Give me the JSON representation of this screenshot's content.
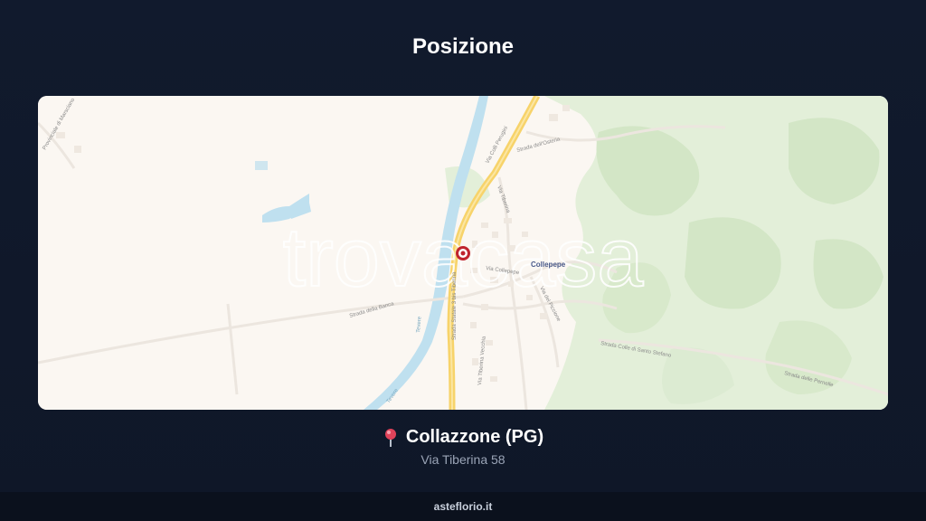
{
  "header": {
    "title": "Posizione"
  },
  "map": {
    "watermark": "trovacasa",
    "marker_icon": "location-marker",
    "labels": {
      "town": "Collepepe",
      "road_banca": "Strada della Banca",
      "road_ss3bis": "Strada Statale 3 bis Tiberina",
      "road_ss3bis_alt": "Tangenziale di Perugia",
      "via_tiberina_1": "Via Tiberina",
      "via_tiberina_2": "Via Tiberina Vecchia",
      "via_del_piccione": "Via del Piccione",
      "strada_osteria": "Strada dell'Osteria",
      "via_colli_perugini": "Via Colli Perugini",
      "strada_santo_stefano": "Strada Colle di Santo Stefano",
      "strada_pernelle": "Strada delle Pernelle",
      "provinciale": "Provinciale di Marsciano",
      "river_1": "Tevere",
      "river_2": "Tevere",
      "via_collepepe": "Via Collepepe"
    },
    "colors": {
      "land": "#fbf7f2",
      "green": "#dcebd2",
      "green_dark": "#cfe4c3",
      "water": "#bfe0ef",
      "highway": "#f7d36a",
      "marker": "#c0242f"
    }
  },
  "location": {
    "pin_icon": "map-pin-icon",
    "name": "Collazzone (PG)",
    "address": "Via Tiberina 58"
  },
  "footer": {
    "site": "asteflorio.it"
  }
}
